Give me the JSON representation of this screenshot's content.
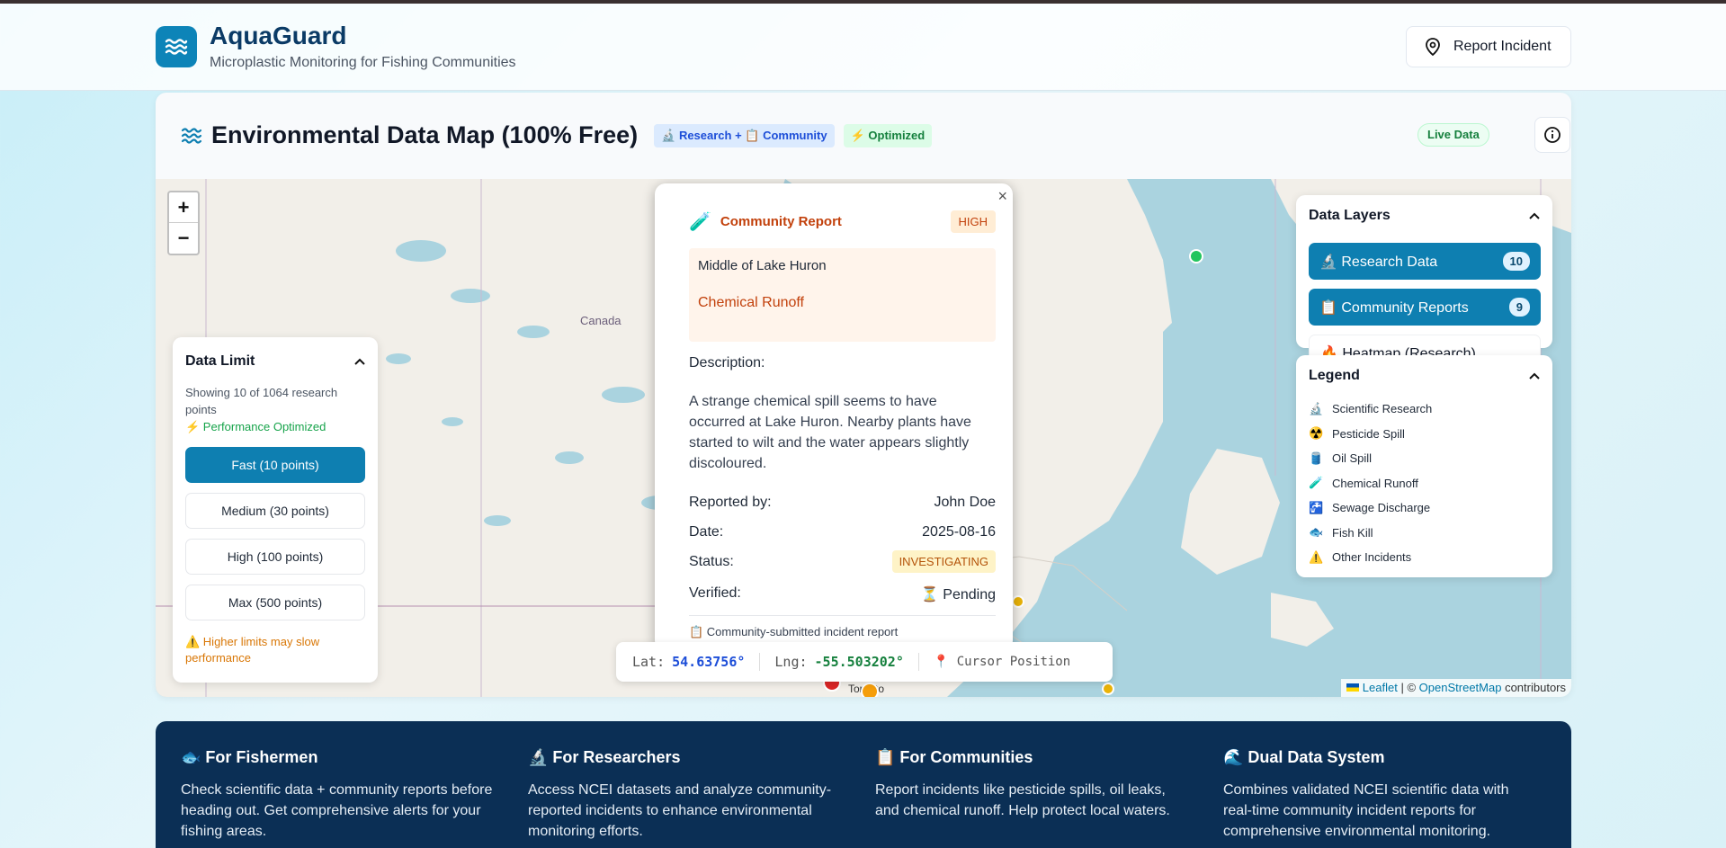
{
  "header": {
    "title": "AquaGuard",
    "subtitle": "Microplastic Monitoring for Fishing Communities",
    "report_button": "Report Incident"
  },
  "map_card": {
    "title": "Environmental Data Map (100% Free)",
    "badge_research": "🔬 Research + 📋 Community",
    "badge_optimized": "⚡ Optimized",
    "live_badge": "Live Data",
    "map_label_canada": "Canada",
    "zoom_in": "+",
    "zoom_out": "−"
  },
  "data_limit": {
    "title": "Data Limit",
    "showing": "Showing 10 of 1064 research points",
    "optimized": "⚡ Performance Optimized",
    "options": [
      {
        "label": "Fast (10 points)",
        "active": true
      },
      {
        "label": "Medium (30 points)",
        "active": false
      },
      {
        "label": "High (100 points)",
        "active": false
      },
      {
        "label": "Max (500 points)",
        "active": false
      }
    ],
    "warning": "⚠️ Higher limits may slow performance"
  },
  "popup": {
    "title": "Community Report",
    "severity": "HIGH",
    "location": "Middle of Lake Huron",
    "incident_type": "Chemical Runoff",
    "description_label": "Description:",
    "description": "A strange chemical spill seems to have occurred at Lake Huron. Nearby plants have started to wilt and the water appears slightly discoloured.",
    "reported_by_label": "Reported by:",
    "reported_by": "John Doe",
    "date_label": "Date:",
    "date": "2025-08-16",
    "status_label": "Status:",
    "status": "INVESTIGATING",
    "verified_label": "Verified:",
    "verified": "⏳ Pending",
    "footnote": "📋 Community-submitted incident report",
    "close": "×"
  },
  "cursor": {
    "lat_label": "Lat:",
    "lat": "54.63756°",
    "lng_label": "Lng:",
    "lng": "-55.503202°",
    "label": "📍 Cursor Position"
  },
  "layers": {
    "title": "Data Layers",
    "items": [
      {
        "label": "🔬 Research Data",
        "count": "10"
      },
      {
        "label": "📋 Community Reports",
        "count": "9"
      },
      {
        "label": "🔥 Heatmap (Research)"
      }
    ]
  },
  "legend": {
    "title": "Legend",
    "items": [
      {
        "icon": "🔬",
        "label": "Scientific Research"
      },
      {
        "icon": "☢️",
        "label": "Pesticide Spill"
      },
      {
        "icon": "🛢️",
        "label": "Oil Spill"
      },
      {
        "icon": "🧪",
        "label": "Chemical Runoff"
      },
      {
        "icon": "🚰",
        "label": "Sewage Discharge"
      },
      {
        "icon": "🐟",
        "label": "Fish Kill"
      },
      {
        "icon": "⚠️",
        "label": "Other Incidents"
      }
    ]
  },
  "attribution": {
    "leaflet": "Leaflet",
    "sep": "| ©",
    "osm": "OpenStreetMap",
    "contrib": "contributors"
  },
  "city_label": "Toronto",
  "footer": {
    "cols": [
      {
        "title": "🐟 For Fishermen",
        "text": "Check scientific data + community reports before heading out. Get comprehensive alerts for your fishing areas."
      },
      {
        "title": "🔬 For Researchers",
        "text": "Access NCEI datasets and analyze community-reported incidents to enhance environmental monitoring efforts."
      },
      {
        "title": "📋 For Communities",
        "text": "Report incidents like pesticide spills, oil leaks, and chemical runoff. Help protect local waters."
      },
      {
        "title": "🌊 Dual Data System",
        "text": "Combines validated NCEI scientific data with real-time community incident reports for comprehensive environmental monitoring."
      }
    ]
  },
  "colors": {
    "primary": "#0e7fb1",
    "brand_dark": "#0b3b66",
    "footer_bg": "#0b2f55",
    "popup_accent": "#c2410c"
  }
}
